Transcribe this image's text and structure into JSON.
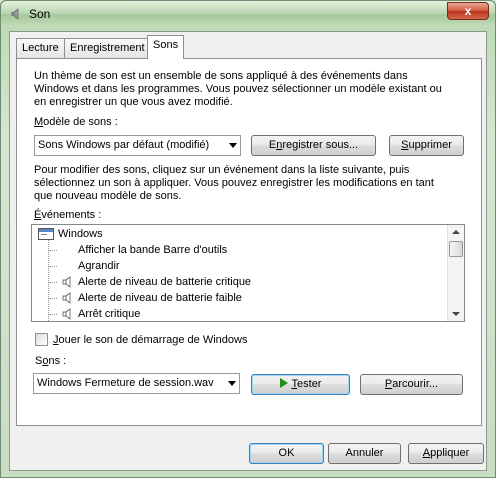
{
  "window": {
    "title": "Son",
    "close_glyph": "x"
  },
  "tabs": [
    {
      "label": "Lecture",
      "active": false
    },
    {
      "label": "Enregistrement",
      "active": false
    },
    {
      "label": "Sons",
      "active": true
    }
  ],
  "intro": {
    "line1": "Un thème de son est un ensemble de sons appliqué à des événements dans",
    "line2": "Windows et dans les programmes. Vous pouvez sélectionner un modèle existant ou",
    "line3": "en enregistrer un que vous avez modifié."
  },
  "scheme": {
    "label_prefix": "",
    "label_u": "M",
    "label_rest": "odèle de sons :",
    "selected": "Sons Windows par défaut (modifié)",
    "save_pre": "E",
    "save_u": "n",
    "save_rest": "registrer sous...",
    "delete_u": "S",
    "delete_rest": "upprimer"
  },
  "instructions": {
    "line1": "Pour modifier des sons, cliquez sur un événement dans la liste suivante, puis",
    "line2": "sélectionnez un son à appliquer. Vous pouvez enregistrer les modifications en tant",
    "line3": "que nouveau modèle de sons."
  },
  "events": {
    "label_u": "É",
    "label_rest": "vénements :",
    "group": "Windows",
    "items": [
      {
        "label": "Afficher la bande Barre d'outils",
        "has_sound": false
      },
      {
        "label": "Agrandir",
        "has_sound": false
      },
      {
        "label": "Alerte de niveau de batterie critique",
        "has_sound": true
      },
      {
        "label": "Alerte de niveau de batterie faible",
        "has_sound": true
      },
      {
        "label": "Arrêt critique",
        "has_sound": true
      }
    ]
  },
  "startup": {
    "label_u": "J",
    "label_rest": "ouer le son de démarrage de Windows",
    "checked": false
  },
  "sounds": {
    "label_pre": "S",
    "label_u": "o",
    "label_rest": "ns :",
    "selected": "Windows Fermeture de session.wav",
    "test_u": "T",
    "test_rest": "ester",
    "browse_u": "P",
    "browse_rest": "arcourir..."
  },
  "footer": {
    "ok": "OK",
    "cancel": "Annuler",
    "apply_u": "A",
    "apply_rest": "ppliquer"
  }
}
